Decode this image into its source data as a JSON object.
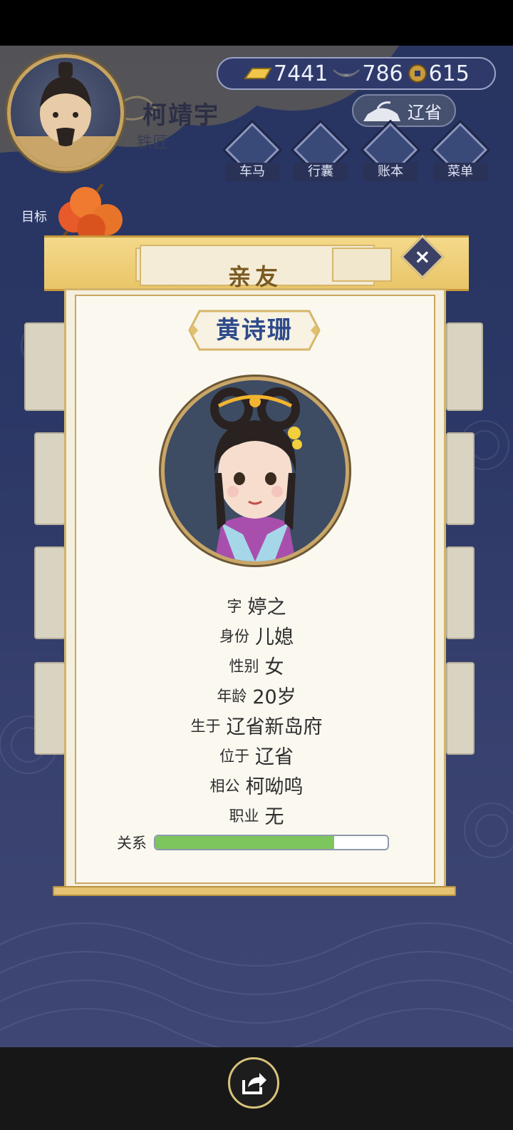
{
  "player": {
    "name": "柯靖宇",
    "title": "铁匠"
  },
  "currency": {
    "gold": "7441",
    "silver": "786",
    "coins": "615"
  },
  "location": "辽省",
  "nav": [
    {
      "label": "车马",
      "icon": "carriage-icon"
    },
    {
      "label": "行囊",
      "icon": "bag-icon"
    },
    {
      "label": "账本",
      "icon": "ledger-icon"
    },
    {
      "label": "菜单",
      "icon": "menu-dots-icon"
    }
  ],
  "goal_label": "目标",
  "modal": {
    "title": "亲友",
    "person_name": "黄诗珊",
    "fields": [
      {
        "key": "字",
        "value": "婷之"
      },
      {
        "key": "身份",
        "value": "儿媳"
      },
      {
        "key": "性别",
        "value": "女"
      },
      {
        "key": "年龄",
        "value": "20岁"
      },
      {
        "key": "生于",
        "value": "辽省新岛府"
      },
      {
        "key": "位于",
        "value": "辽省"
      },
      {
        "key": "相公",
        "value": "柯呦鸣"
      },
      {
        "key": "职业",
        "value": "无"
      }
    ],
    "relation_label": "关系",
    "relation_level": 0.77
  },
  "colors": {
    "accent_gold": "#e9c568",
    "relation_fill": "#7dc55d",
    "name_blue": "#2e4a8a"
  }
}
